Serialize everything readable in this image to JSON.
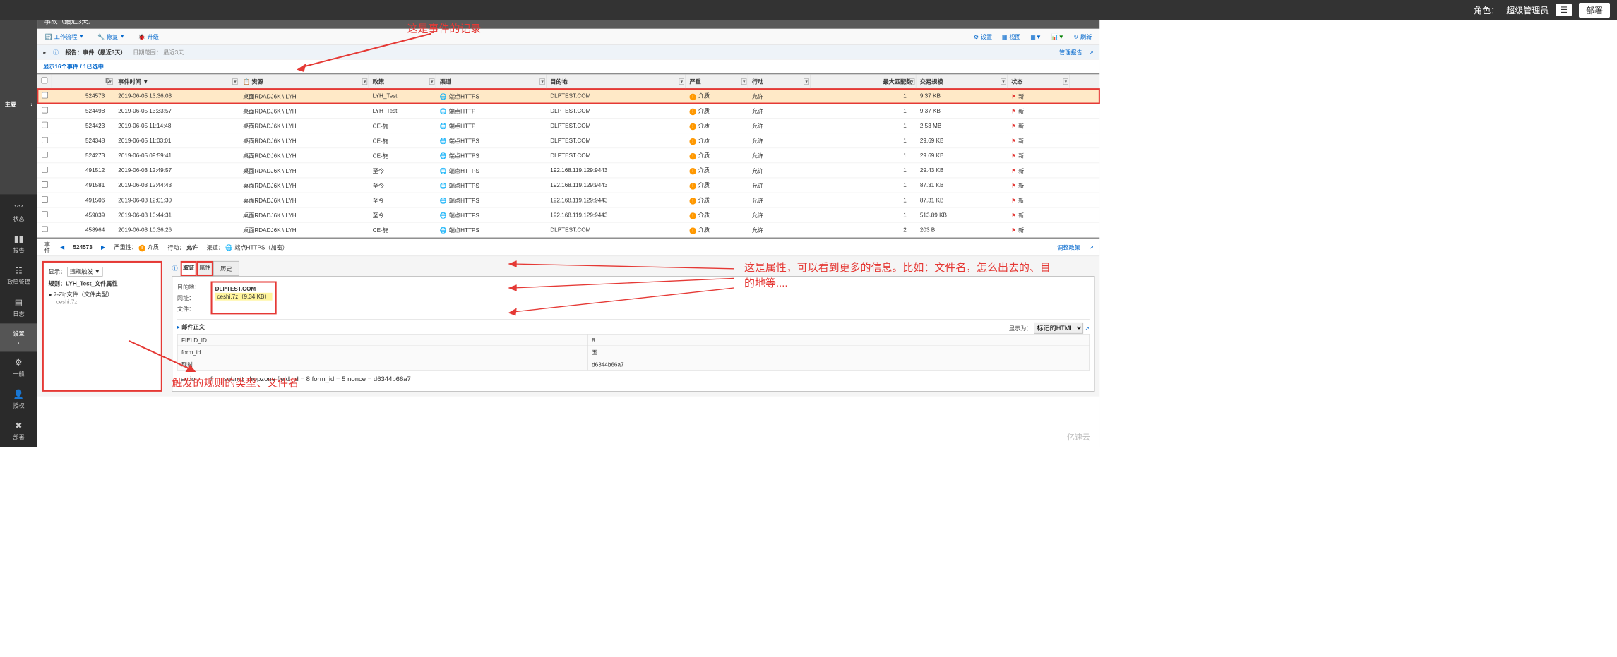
{
  "topbar": {
    "role_label": "角色：",
    "role_value": "超级管理员",
    "btn": "部署"
  },
  "sidebar": {
    "main": "主要",
    "items": [
      {
        "label": "状态"
      },
      {
        "label": "报告"
      },
      {
        "label": "政策管理"
      },
      {
        "label": "日志"
      },
      {
        "label": "设置",
        "active": true
      },
      {
        "label": "一般"
      },
      {
        "label": "授权"
      },
      {
        "label": "部署"
      }
    ]
  },
  "title": "事故（最近3天）",
  "toolbar": {
    "workflow": "工作流程",
    "repair": "修复",
    "upgrade": "升级",
    "settings": "设置",
    "view": "视图",
    "refresh": "刷新"
  },
  "report_bar": {
    "prefix": "报告：",
    "name": "事件（最近3天）",
    "date_label": "日期范围：",
    "date_value": "最近3天",
    "manage": "管理报告"
  },
  "count_text": "显示16个事件 / 1已选中",
  "columns": {
    "id": "ID",
    "time": "事件时间",
    "resource": "资源",
    "policy": "政策",
    "channel": "渠道",
    "dest": "目的地",
    "severity": "严重",
    "action": "行动",
    "match": "最大匹配数",
    "trans": "交易规模",
    "status": "状态"
  },
  "rows": [
    {
      "id": "524573",
      "time": "2019-06-05 13:36:03",
      "res": "桌面RDADJ6K \\ LYH",
      "pol": "LYH_Test",
      "chan": "端点HTTPS",
      "dest": "DLPTEST.COM",
      "sev": "介质",
      "act": "允许",
      "match": "1",
      "trans": "9.37 KB",
      "status": "新",
      "selected": true
    },
    {
      "id": "524498",
      "time": "2019-06-05 13:33:57",
      "res": "桌面RDADJ6K \\ LYH",
      "pol": "LYH_Test",
      "chan": "端点HTTP",
      "dest": "DLPTEST.COM",
      "sev": "介质",
      "act": "允许",
      "match": "1",
      "trans": "9.37 KB",
      "status": "新"
    },
    {
      "id": "524423",
      "time": "2019-06-05 11:14:48",
      "res": "桌面RDADJ6K \\ LYH",
      "pol": "CE-施",
      "chan": "端点HTTP",
      "dest": "DLPTEST.COM",
      "sev": "介质",
      "act": "允许",
      "match": "1",
      "trans": "2.53 MB",
      "status": "新"
    },
    {
      "id": "524348",
      "time": "2019-06-05 11:03:01",
      "res": "桌面RDADJ6K \\ LYH",
      "pol": "CE-施",
      "chan": "端点HTTPS",
      "dest": "DLPTEST.COM",
      "sev": "介质",
      "act": "允许",
      "match": "1",
      "trans": "29.69 KB",
      "status": "新"
    },
    {
      "id": "524273",
      "time": "2019-06-05 09:59:41",
      "res": "桌面RDADJ6K \\ LYH",
      "pol": "CE-施",
      "chan": "端点HTTPS",
      "dest": "DLPTEST.COM",
      "sev": "介质",
      "act": "允许",
      "match": "1",
      "trans": "29.69 KB",
      "status": "新"
    },
    {
      "id": "491512",
      "time": "2019-06-03 12:49:57",
      "res": "桌面RDADJ6K \\ LYH",
      "pol": "至今",
      "chan": "端点HTTPS",
      "dest": "192.168.119.129:9443",
      "sev": "介质",
      "act": "允许",
      "match": "1",
      "trans": "29.43 KB",
      "status": "新"
    },
    {
      "id": "491581",
      "time": "2019-06-03 12:44:43",
      "res": "桌面RDADJ6K \\ LYH",
      "pol": "至今",
      "chan": "端点HTTPS",
      "dest": "192.168.119.129:9443",
      "sev": "介质",
      "act": "允许",
      "match": "1",
      "trans": "87.31 KB",
      "status": "新"
    },
    {
      "id": "491506",
      "time": "2019-06-03 12:01:30",
      "res": "桌面RDADJ6K \\ LYH",
      "pol": "至今",
      "chan": "端点HTTPS",
      "dest": "192.168.119.129:9443",
      "sev": "介质",
      "act": "允许",
      "match": "1",
      "trans": "87.31 KB",
      "status": "新"
    },
    {
      "id": "459039",
      "time": "2019-06-03 10:44:31",
      "res": "桌面RDADJ6K \\ LYH",
      "pol": "至今",
      "chan": "端点HTTPS",
      "dest": "192.168.119.129:9443",
      "sev": "介质",
      "act": "允许",
      "match": "1",
      "trans": "513.89 KB",
      "status": "新"
    },
    {
      "id": "458964",
      "time": "2019-06-03 10:36:26",
      "res": "桌面RDADJ6K \\ LYH",
      "pol": "CE-施",
      "chan": "端点HTTPS",
      "dest": "DLPTEST.COM",
      "sev": "介质",
      "act": "允许",
      "match": "2",
      "trans": "203 B",
      "status": "新"
    }
  ],
  "detail": {
    "side_label": "事件",
    "id": "524573",
    "sev_label": "严重性：",
    "sev_val": "介质",
    "act_label": "行动：",
    "act_val": "允许",
    "chan_label": "渠道：",
    "chan_val": "端点HTTPS（加密）",
    "adjust": "调整政策",
    "show_label": "显示：",
    "show_val": "违规触发 ▼",
    "rule_title": "规则：LYH_Test_文件属性",
    "rule_item": "7-Zip文件（文件类型）",
    "rule_file": "ceshi.7z",
    "tabs": {
      "evidence": "取证",
      "props": "属性",
      "history": "历史"
    },
    "dest_lbl": "目的地：",
    "url_lbl": "网址：",
    "file_lbl": "文件：",
    "dest_val": "DLPTEST.COM",
    "file_val": "ceshi.7z（9.34 KB）",
    "mail_body": "邮件正文",
    "display_as_lbl": "显示为：",
    "display_as_val": "标记的HTML",
    "fields": [
      {
        "k": "FIELD_ID",
        "v": "8"
      },
      {
        "k": "form_id",
        "v": "五"
      },
      {
        "k": "现时",
        "v": "d6344b66a7"
      }
    ],
    "action_line": "action_ = frm_submit_dropzone field_id = 8 form_id = 5 nonce = d6344b66a7"
  },
  "annotations": {
    "a1": "这是事件的记录",
    "a2": "这是属性，可以看到更多的信息。比如：文件名，怎么出去的、目的地等....",
    "a3": "触发的规则的类型、文件名"
  },
  "watermark": "亿速云"
}
